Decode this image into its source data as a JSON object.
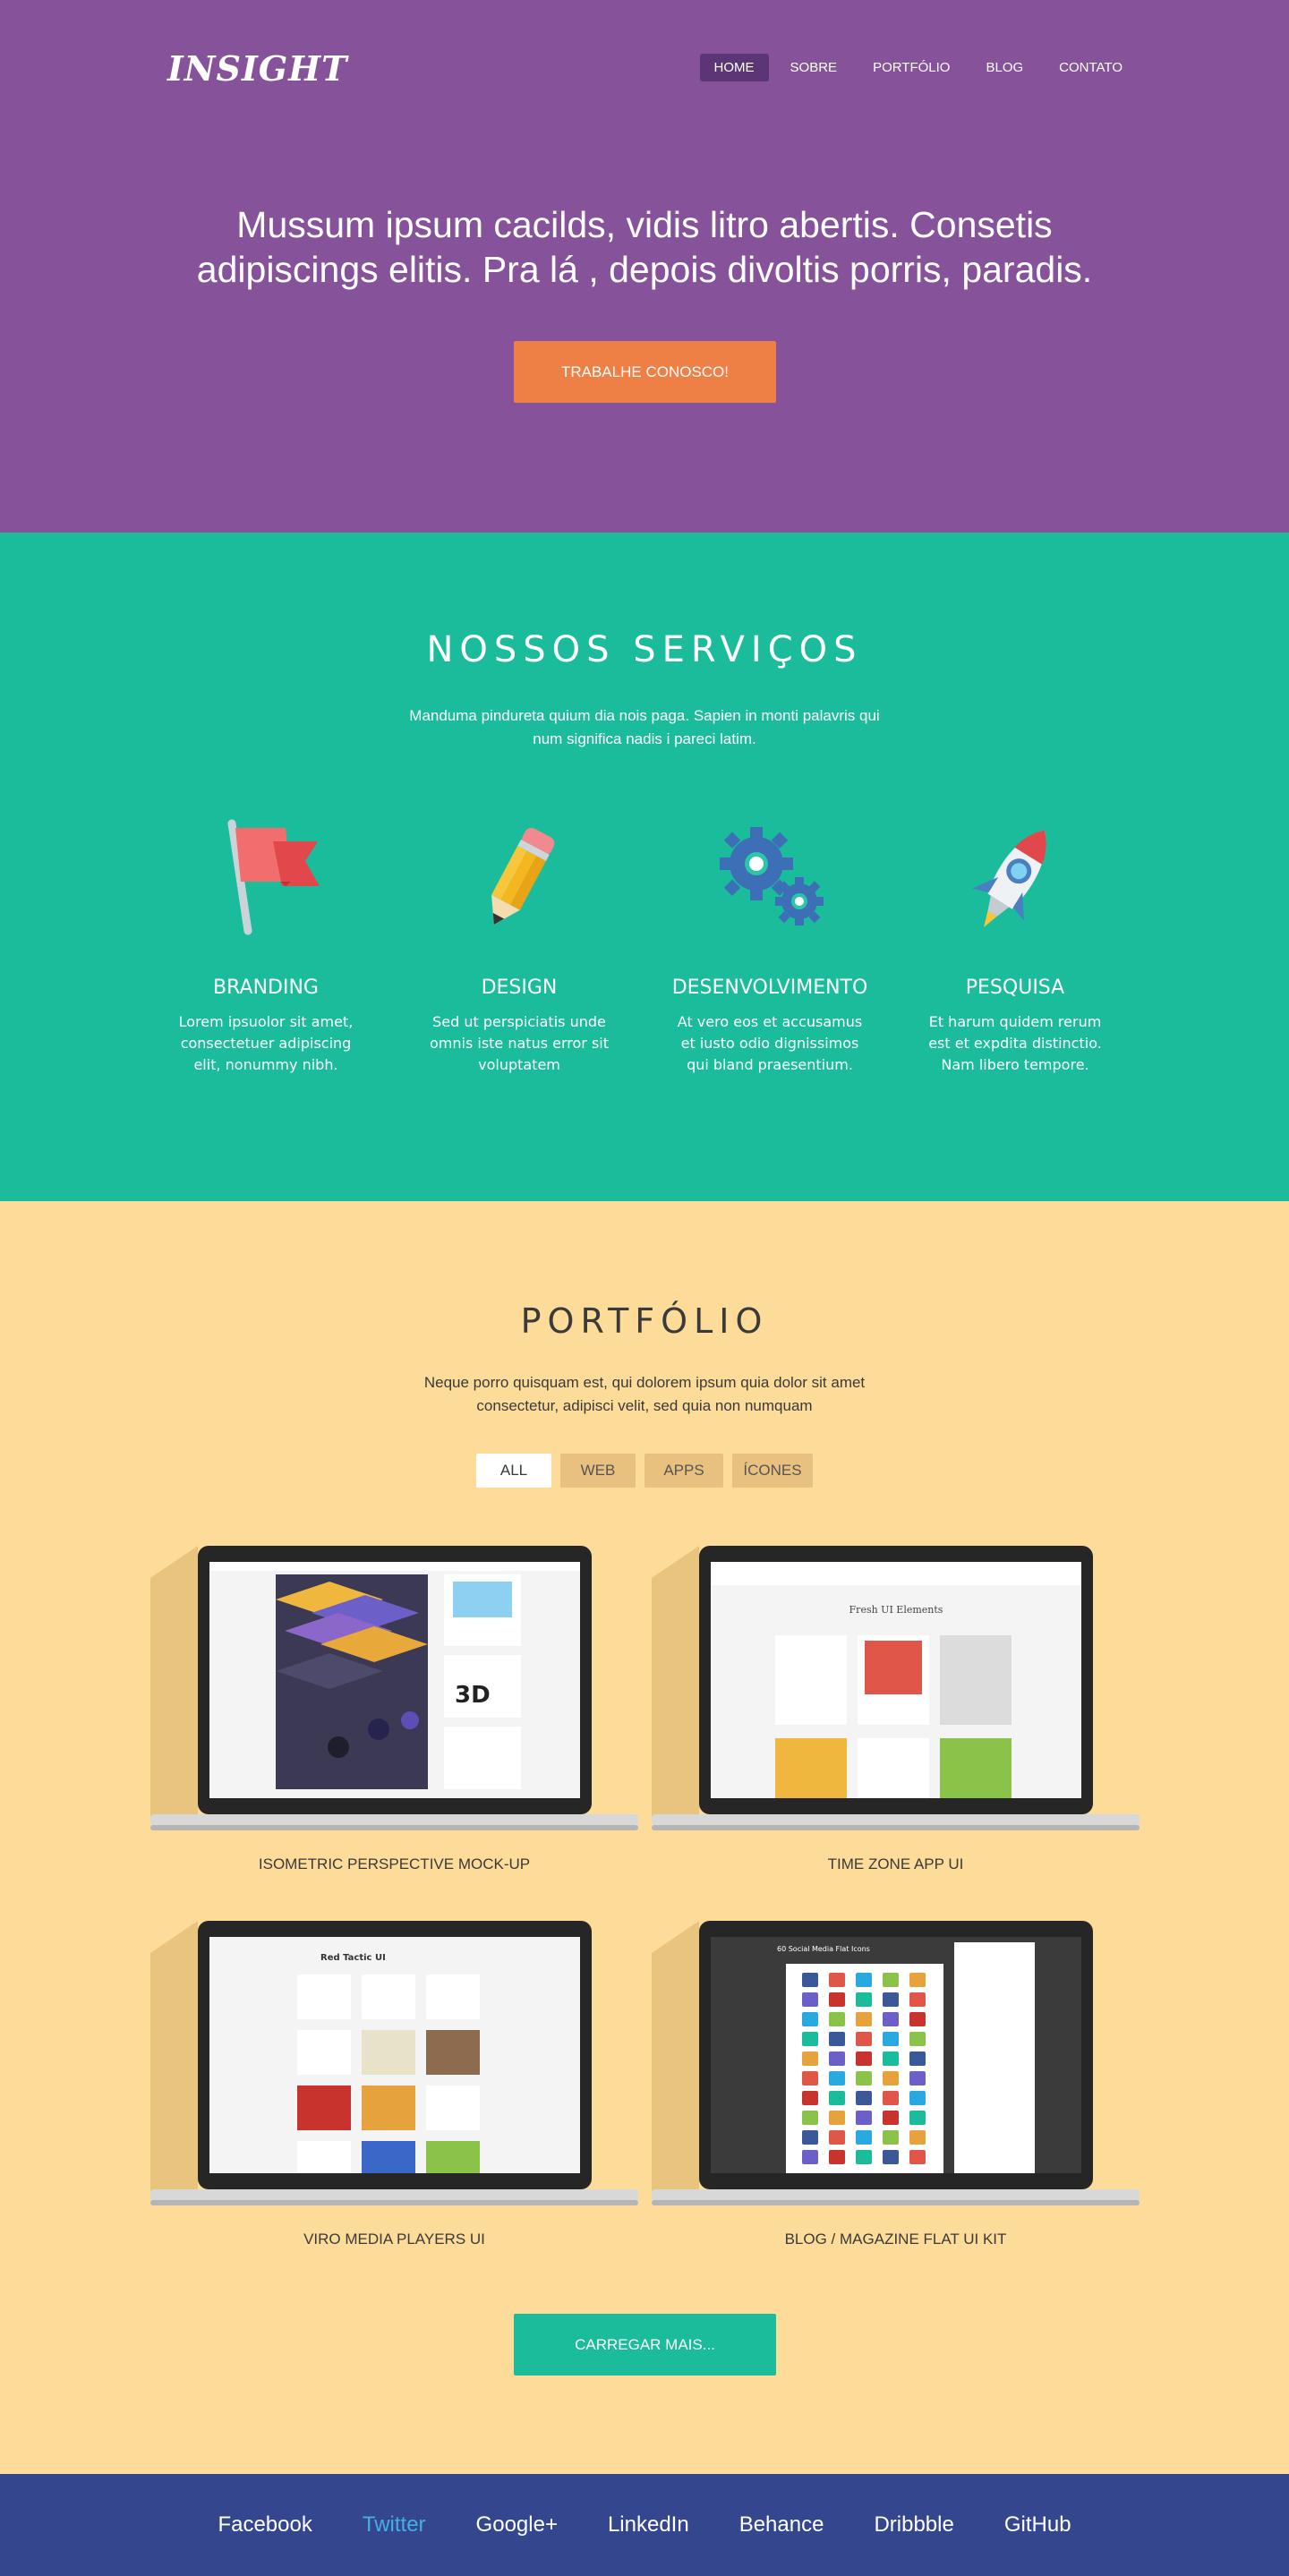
{
  "header": {
    "logo": "INSIGHT",
    "nav": [
      {
        "label": "HOME",
        "active": true
      },
      {
        "label": "SOBRE",
        "active": false
      },
      {
        "label": "PORTFÓLIO",
        "active": false
      },
      {
        "label": "BLOG",
        "active": false
      },
      {
        "label": "CONTATO",
        "active": false
      }
    ],
    "headline_line1": "Mussum ipsum cacilds, vidis litro abertis. Consetis",
    "headline_line2": "adipiscings elitis. Pra lá , depois divoltis porris, paradis.",
    "cta_label": "TRABALHE CONOSCO!"
  },
  "services": {
    "title": "NOSSOS SERVIÇOS",
    "subtitle_line1": "Manduma pindureta quium dia nois paga. Sapien in monti palavris qui",
    "subtitle_line2": "num significa nadis i pareci latim.",
    "items": [
      {
        "name": "BRANDING",
        "icon": "flag-icon",
        "desc": [
          "Lorem ipsuolor sit amet,",
          "consectetuer adipiscing",
          "elit,  nonummy nibh."
        ]
      },
      {
        "name": "DESIGN",
        "icon": "pencil-icon",
        "desc": [
          "Sed ut perspiciatis unde",
          "omnis iste natus error sit",
          "voluptatem"
        ]
      },
      {
        "name": "DESENVOLVIMENTO",
        "icon": "gears-icon",
        "desc": [
          "At vero eos et accusamus",
          "et iusto odio dignissimos",
          "qui bland praesentium."
        ]
      },
      {
        "name": "PESQUISA",
        "icon": "rocket-icon",
        "desc": [
          "Et harum quidem rerum",
          "est et expdita distinctio.",
          "Nam libero tempore."
        ]
      }
    ]
  },
  "portfolio": {
    "title": "PORTFÓLIO",
    "subtitle_line1": "Neque porro quisquam est, qui dolorem ipsum quia dolor sit amet",
    "subtitle_line2": "consectetur, adipisci velit, sed quia non numquam",
    "filters": [
      {
        "label": "ALL",
        "active": true
      },
      {
        "label": "WEB",
        "active": false
      },
      {
        "label": "APPS",
        "active": false
      },
      {
        "label": "ÍCONES",
        "active": false
      }
    ],
    "items": [
      {
        "title": "ISOMETRIC PERSPECTIVE MOCK-UP",
        "screen": "light"
      },
      {
        "title": "TIME ZONE APP UI",
        "screen": "light",
        "screen_heading": "Fresh UI Elements"
      },
      {
        "title": "VIRO MEDIA PLAYERS UI",
        "screen": "light",
        "screen_heading": "Red Tactic UI"
      },
      {
        "title": "BLOG / MAGAZINE FLAT UI KIT",
        "screen": "dark",
        "screen_heading": "60 Social Media Flat Icons"
      }
    ],
    "load_more": "CARREGAR MAIS..."
  },
  "footer": {
    "links": [
      {
        "label": "Facebook",
        "active": false
      },
      {
        "label": "Twitter",
        "active": true
      },
      {
        "label": "Google+",
        "active": false
      },
      {
        "label": "LinkedIn",
        "active": false
      },
      {
        "label": "Behance",
        "active": false
      },
      {
        "label": "Dribbble",
        "active": false
      },
      {
        "label": "GitHub",
        "active": false
      }
    ]
  },
  "colors": {
    "hero_bg": "#86539b",
    "services_bg": "#1abc9c",
    "portfolio_bg": "#fddb99",
    "footer_bg": "#34478e",
    "cta_orange": "#ee7f45",
    "twitter_blue": "#45aee0"
  }
}
